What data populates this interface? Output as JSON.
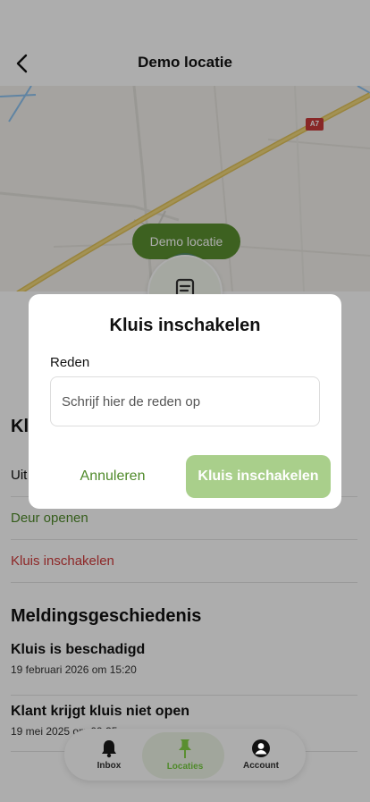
{
  "header": {
    "title": "Demo locatie",
    "back_icon": "chevron-left-icon"
  },
  "map": {
    "pin_label": "Demo locatie",
    "road_shield": "A7",
    "notes_icon": "note-icon"
  },
  "section": {
    "title_partial": "Kl",
    "rows": [
      {
        "label": "Uit"
      },
      {
        "label": "Deur openen",
        "color": "#4f8a2a"
      },
      {
        "label": "Kluis inschakelen",
        "color": "#d03a3a"
      }
    ]
  },
  "history": {
    "title": "Meldingsgeschiedenis",
    "items": [
      {
        "title": "Kluis is beschadigd",
        "date": "19 februari 2026 om 15:20"
      },
      {
        "title": "Klant krijgt kluis niet open",
        "date": "19 mei 2025 om 09:35"
      }
    ]
  },
  "nav": {
    "items": [
      {
        "label": "Inbox",
        "icon": "bell-icon"
      },
      {
        "label": "Locaties",
        "icon": "pin-icon",
        "active": true
      },
      {
        "label": "Account",
        "icon": "user-icon"
      }
    ]
  },
  "dialog": {
    "title": "Kluis inschakelen",
    "field_label": "Reden",
    "placeholder": "Schrijf hier de reden op",
    "value": "",
    "cancel_label": "Annuleren",
    "confirm_label": "Kluis inschakelen"
  },
  "colors": {
    "accent": "#5a8f30",
    "accent_light": "#a9cf8b",
    "danger": "#d03a3a",
    "location_dot": "#1a66d6"
  }
}
